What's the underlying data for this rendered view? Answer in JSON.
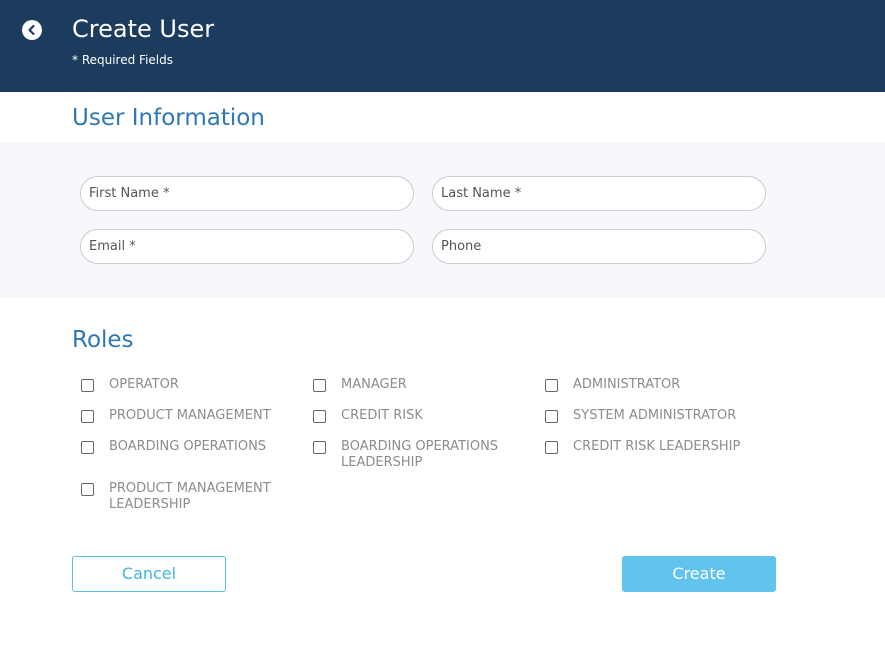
{
  "header": {
    "title": "Create User",
    "required_note": "* Required Fields"
  },
  "user_info": {
    "title": "User Information",
    "fields": {
      "first_name": {
        "placeholder": "First Name *",
        "value": ""
      },
      "last_name": {
        "placeholder": "Last Name *",
        "value": ""
      },
      "email": {
        "placeholder": "Email *",
        "value": ""
      },
      "phone": {
        "placeholder": "Phone",
        "value": ""
      }
    }
  },
  "roles": {
    "title": "Roles",
    "items": [
      {
        "label": "OPERATOR",
        "checked": false
      },
      {
        "label": "MANAGER",
        "checked": false
      },
      {
        "label": "ADMINISTRATOR",
        "checked": false
      },
      {
        "label": "PRODUCT MANAGEMENT",
        "checked": false
      },
      {
        "label": "CREDIT RISK",
        "checked": false
      },
      {
        "label": "SYSTEM ADMINISTRATOR",
        "checked": false
      },
      {
        "label": "BOARDING OPERATIONS",
        "checked": false
      },
      {
        "label": "BOARDING OPERATIONS LEADERSHIP",
        "checked": false
      },
      {
        "label": "CREDIT RISK LEADERSHIP",
        "checked": false
      },
      {
        "label": "PRODUCT MANAGEMENT LEADERSHIP",
        "checked": false
      }
    ]
  },
  "actions": {
    "cancel_label": "Cancel",
    "create_label": "Create"
  },
  "colors": {
    "header_bg": "#1c3c5e",
    "section_title": "#2e78b8",
    "accent": "#62c3ee"
  }
}
